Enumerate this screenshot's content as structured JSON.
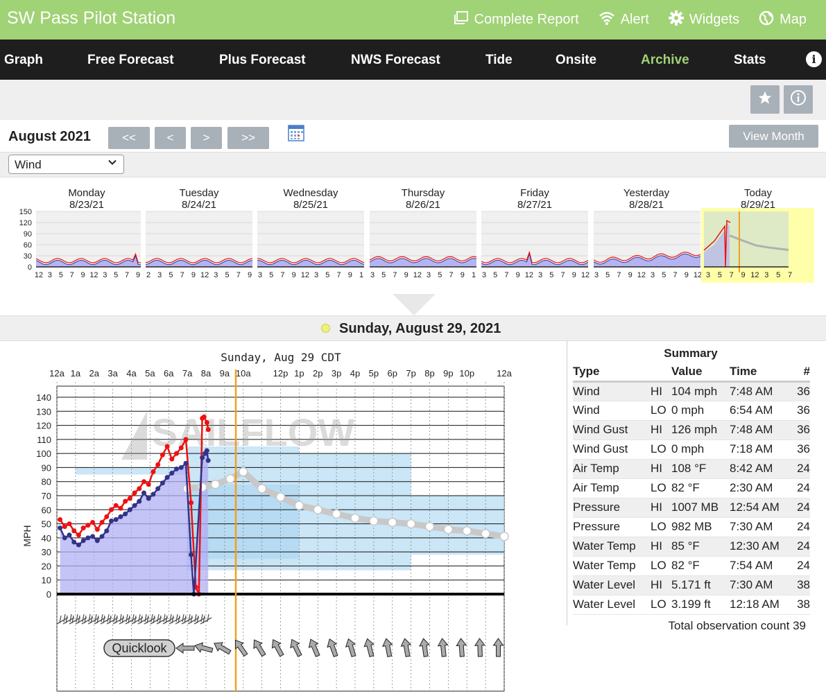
{
  "header": {
    "title": "SW Pass Pilot Station",
    "links": [
      {
        "label": "Complete Report",
        "icon": "report-icon"
      },
      {
        "label": "Alert",
        "icon": "wifi-alert-icon"
      },
      {
        "label": "Widgets",
        "icon": "gear-icon"
      },
      {
        "label": "Map",
        "icon": "globe-icon"
      }
    ]
  },
  "nav": {
    "items": [
      "Graph",
      "Free Forecast",
      "Plus Forecast",
      "NWS Forecast",
      "Tide",
      "Onsite",
      "Archive",
      "Stats"
    ],
    "active": "Archive",
    "info_icon": "info-circle-icon"
  },
  "toolbar": {
    "favorite_icon": "star-icon",
    "info_icon": "info-icon"
  },
  "month_nav": {
    "label": "August 2021",
    "buttons": [
      "<<",
      "<",
      ">",
      ">>"
    ],
    "calendar_icon": "calendar-icon",
    "view_month": "View Month"
  },
  "select": {
    "value": "Wind"
  },
  "days": [
    {
      "name": "Monday",
      "date": "8/23/21",
      "ticks": "12 3 5 7 9 12 3 5 7 9"
    },
    {
      "name": "Tuesday",
      "date": "8/24/21",
      "ticks": "2 3 5 7 9 12 3 5 7 9"
    },
    {
      "name": "Wednesday",
      "date": "8/25/21",
      "ticks": "3 5 7 9 12 3 5 7 9 1"
    },
    {
      "name": "Thursday",
      "date": "8/26/21",
      "ticks": "3 5 7 9 12 3 5 7 9 1"
    },
    {
      "name": "Friday",
      "date": "8/27/21",
      "ticks": "3 5 7 9 12 3 5 7 9 12"
    },
    {
      "name": "Yesterday",
      "date": "8/28/21",
      "ticks": "3 5 7 9 12 3 5 7 9 12"
    },
    {
      "name": "Today",
      "date": "8/29/21",
      "ticks": "3 5 7 9 12 3 5 7"
    }
  ],
  "mini_yticks": [
    "150",
    "120",
    "90",
    "60",
    "30",
    "0"
  ],
  "selected_day": "Sunday, August 29, 2021",
  "main_chart": {
    "title": "Sunday, Aug 29 CDT",
    "watermark": "SAILFLOW",
    "quicklook": "Quicklook",
    "ylabel": "MPH",
    "hour_labels": [
      "12a",
      "1a",
      "2a",
      "3a",
      "4a",
      "5a",
      "6a",
      "7a",
      "8a",
      "9a",
      "10a",
      "12p",
      "1p",
      "2p",
      "3p",
      "4p",
      "5p",
      "6p",
      "7p",
      "8p",
      "9p",
      "10p",
      "12a"
    ]
  },
  "chart_data": {
    "type": "line",
    "title": "Sunday, Aug 29 CDT",
    "ylabel": "MPH",
    "ylim": [
      0,
      140
    ],
    "yticks": [
      0,
      10,
      20,
      30,
      40,
      50,
      60,
      70,
      80,
      90,
      100,
      110,
      120,
      130,
      140
    ],
    "x_unit": "hours after midnight",
    "xlim": [
      0,
      24
    ],
    "series": [
      {
        "name": "Wind Gust",
        "color": "#ee1111",
        "x": [
          0.17,
          0.42,
          0.67,
          0.92,
          1.17,
          1.42,
          1.67,
          1.92,
          2.17,
          2.42,
          2.67,
          2.92,
          3.17,
          3.42,
          3.67,
          3.92,
          4.17,
          4.42,
          4.67,
          4.92,
          5.17,
          5.42,
          5.67,
          5.92,
          6.17,
          6.42,
          6.67,
          6.92,
          7.2,
          7.45,
          7.62,
          7.8,
          7.9,
          8.05,
          8.12
        ],
        "y": [
          53,
          48,
          50,
          45,
          42,
          47,
          49,
          51,
          46,
          51,
          55,
          60,
          63,
          61,
          66,
          68,
          72,
          75,
          80,
          78,
          87,
          92,
          99,
          105,
          96,
          100,
          104,
          110,
          65,
          5,
          0,
          125,
          126,
          122,
          117
        ]
      },
      {
        "name": "Wind",
        "color": "#333388",
        "x": [
          0.17,
          0.42,
          0.67,
          0.92,
          1.17,
          1.42,
          1.67,
          1.92,
          2.17,
          2.42,
          2.67,
          2.92,
          3.17,
          3.42,
          3.67,
          3.92,
          4.17,
          4.42,
          4.67,
          4.92,
          5.17,
          5.42,
          5.67,
          5.92,
          6.17,
          6.42,
          6.67,
          6.92,
          7.2,
          7.35,
          7.8,
          7.95,
          8.05,
          8.12
        ],
        "y": [
          47,
          40,
          42,
          37,
          35,
          38,
          40,
          41,
          38,
          41,
          45,
          52,
          53,
          55,
          57,
          60,
          63,
          66,
          72,
          68,
          71,
          75,
          79,
          83,
          86,
          89,
          90,
          93,
          28,
          0,
          97,
          100,
          102,
          95
        ]
      }
    ],
    "forecast": {
      "current_time_hours": 9.6,
      "points_x": [
        7.0,
        7.8,
        8.5,
        9.3,
        10.0,
        11.0,
        12.0,
        13.0,
        14.0,
        15.0,
        16.0,
        17.0,
        18.0,
        19.0,
        20.0,
        21.0,
        22.0,
        23.0,
        24.0
      ],
      "points_y": [
        75,
        76,
        78,
        82,
        87,
        75,
        69,
        63,
        60,
        57,
        54,
        52,
        51,
        50,
        48,
        46,
        45,
        43,
        41
      ]
    }
  },
  "summary": {
    "title": "Summary",
    "columns": [
      "Type",
      "",
      "Value",
      "Time",
      "#"
    ],
    "rows": [
      [
        "Wind",
        "HI",
        "104 mph",
        "7:48 AM",
        "36"
      ],
      [
        "Wind",
        "LO",
        "0 mph",
        "6:54 AM",
        "36"
      ],
      [
        "Wind Gust",
        "HI",
        "126 mph",
        "7:48 AM",
        "36"
      ],
      [
        "Wind Gust",
        "LO",
        "0 mph",
        "7:18 AM",
        "36"
      ],
      [
        "Air Temp",
        "HI",
        "108 °F",
        "8:42 AM",
        "24"
      ],
      [
        "Air Temp",
        "LO",
        "82 °F",
        "2:30 AM",
        "24"
      ],
      [
        "Pressure",
        "HI",
        "1007 MB",
        "12:54 AM",
        "24"
      ],
      [
        "Pressure",
        "LO",
        "982 MB",
        "7:30 AM",
        "24"
      ],
      [
        "Water Temp",
        "HI",
        "85 °F",
        "12:30 AM",
        "24"
      ],
      [
        "Water Temp",
        "LO",
        "82 °F",
        "7:54 AM",
        "24"
      ],
      [
        "Water Level",
        "HI",
        "5.171 ft",
        "7:30 AM",
        "38"
      ],
      [
        "Water Level",
        "LO",
        "3.199 ft",
        "12:18 AM",
        "38"
      ]
    ],
    "total_label": "Total observation count",
    "total_value": "39"
  }
}
